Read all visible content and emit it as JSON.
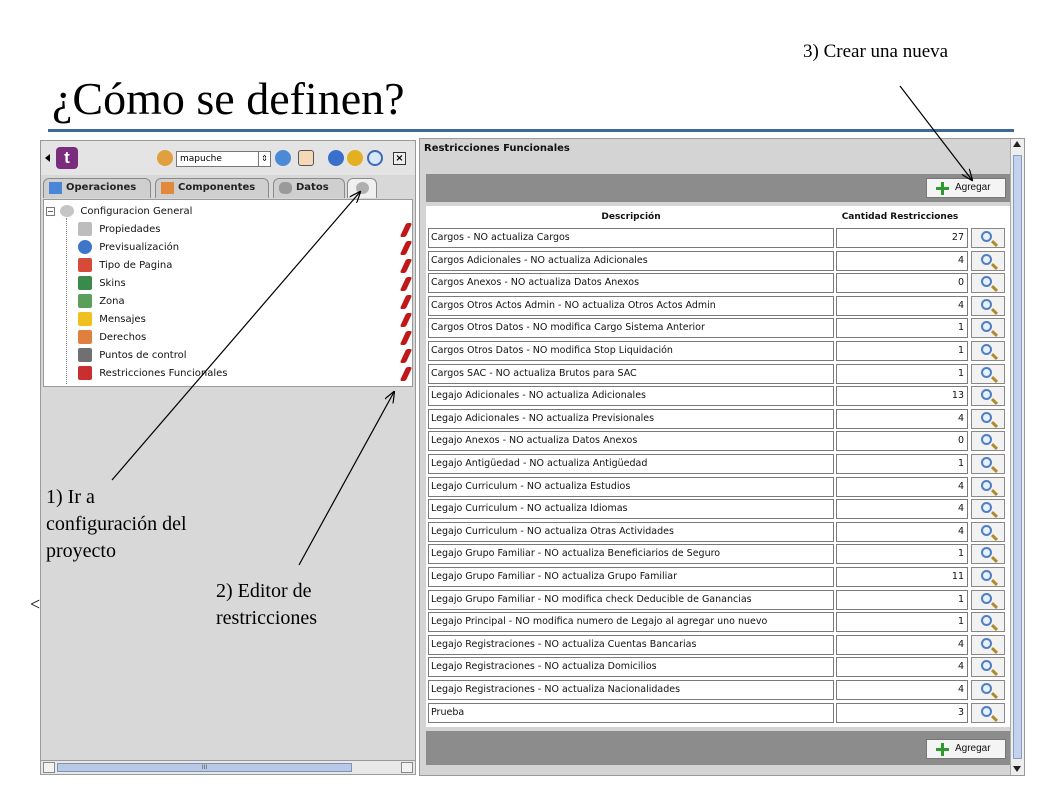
{
  "slide": {
    "title": "¿Cómo se definen?",
    "note_3": "3) Crear una nueva",
    "note_1": "1) Ir a configuración del proyecto",
    "note_2": "2) Editor de restricciones",
    "stray_caret": "<"
  },
  "left_panel": {
    "logo_letter": "t",
    "project_select_value": "mapuche",
    "tabs": [
      {
        "label": "Operaciones"
      },
      {
        "label": "Componentes"
      },
      {
        "label": "Datos"
      }
    ],
    "tree": {
      "root_label": "Configuracion General",
      "items": [
        {
          "label": "Propiedades",
          "icon": "properties-icon"
        },
        {
          "label": "Previsualización",
          "icon": "preview-icon"
        },
        {
          "label": "Tipo de Pagina",
          "icon": "page-type-icon"
        },
        {
          "label": "Skins",
          "icon": "skins-icon"
        },
        {
          "label": "Zona",
          "icon": "zone-icon"
        },
        {
          "label": "Mensajes",
          "icon": "warning-icon"
        },
        {
          "label": "Derechos",
          "icon": "rights-icon"
        },
        {
          "label": "Puntos de control",
          "icon": "tools-icon"
        },
        {
          "label": "Restricciones Funcionales",
          "icon": "restrictions-icon"
        }
      ]
    },
    "hscroll_grip": "III"
  },
  "right_panel": {
    "title": "Restricciones Funcionales",
    "add_button_label": "Agregar",
    "columns": [
      "Descripción",
      "Cantidad Restricciones"
    ],
    "rows": [
      {
        "desc": "Cargos - NO actualiza Cargos",
        "count": "27"
      },
      {
        "desc": "Cargos Adicionales - NO actualiza Adicionales",
        "count": "4"
      },
      {
        "desc": "Cargos Anexos - NO actualiza Datos Anexos",
        "count": "0"
      },
      {
        "desc": "Cargos Otros Actos Admin - NO actualiza Otros Actos Admin",
        "count": "4"
      },
      {
        "desc": "Cargos Otros Datos - NO modifica Cargo Sistema Anterior",
        "count": "1"
      },
      {
        "desc": "Cargos Otros Datos - NO modifica Stop Liquidación",
        "count": "1"
      },
      {
        "desc": "Cargos SAC - NO actualiza Brutos para SAC",
        "count": "1"
      },
      {
        "desc": "Legajo Adicionales - NO actualiza Adicionales",
        "count": "13"
      },
      {
        "desc": "Legajo Adicionales - NO actualiza Previsionales",
        "count": "4"
      },
      {
        "desc": "Legajo Anexos - NO actualiza Datos Anexos",
        "count": "0"
      },
      {
        "desc": "Legajo Antigüedad - NO actualiza Antigüedad",
        "count": "1"
      },
      {
        "desc": "Legajo Curriculum - NO actualiza Estudios",
        "count": "4"
      },
      {
        "desc": "Legajo Curriculum - NO actualiza Idiomas",
        "count": "4"
      },
      {
        "desc": "Legajo Curriculum - NO actualiza Otras Actividades",
        "count": "4"
      },
      {
        "desc": "Legajo Grupo Familiar - NO actualiza Beneficiarios de Seguro",
        "count": "1"
      },
      {
        "desc": "Legajo Grupo Familiar - NO actualiza Grupo Familiar",
        "count": "11"
      },
      {
        "desc": "Legajo Grupo Familiar - NO modifica check Deducible de Ganancias",
        "count": "1"
      },
      {
        "desc": "Legajo Principal - NO modifica numero de Legajo al agregar uno nuevo",
        "count": "1"
      },
      {
        "desc": "Legajo Registraciones - NO actualiza Cuentas Bancarias",
        "count": "4"
      },
      {
        "desc": "Legajo Registraciones - NO actualiza Domicilios",
        "count": "4"
      },
      {
        "desc": "Legajo Registraciones - NO actualiza Nacionalidades",
        "count": "4"
      },
      {
        "desc": "Prueba",
        "count": "3"
      }
    ]
  },
  "colors": {
    "title_rule": "#3d6a9a",
    "toolbar_logo": "#7a2d7d",
    "pencil": "#c01818",
    "add_plus": "#2e9a2e"
  }
}
